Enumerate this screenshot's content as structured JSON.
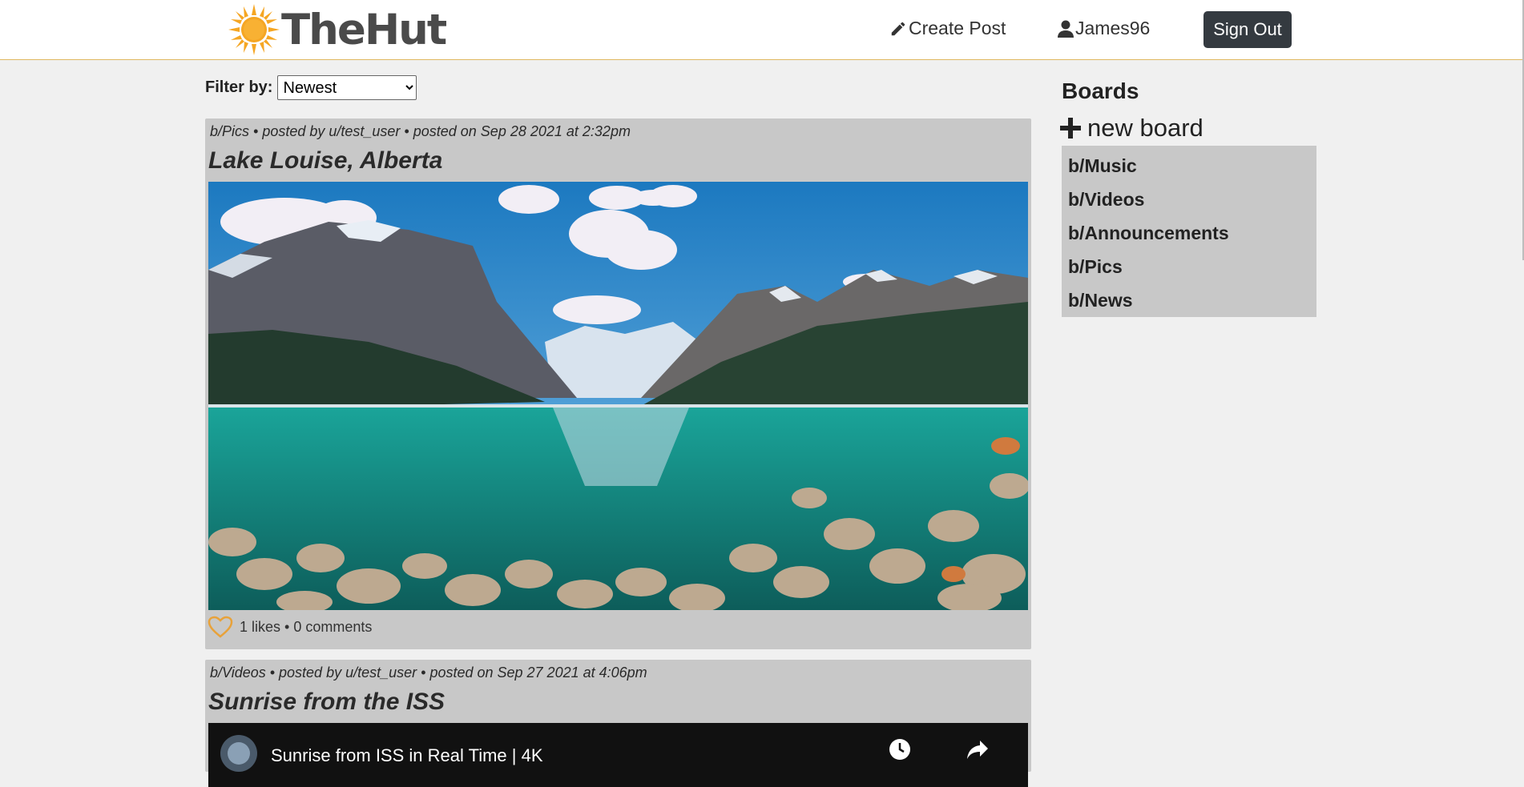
{
  "app": {
    "logo_text": "TheHut"
  },
  "nav": {
    "create_post": "Create Post",
    "username": "James96",
    "sign_out": "Sign Out"
  },
  "filter": {
    "label": "Filter by:",
    "selected": "Newest",
    "options": [
      "Newest"
    ]
  },
  "posts": [
    {
      "meta": "b/Pics • posted by u/test_user • posted on Sep 28 2021 at 2:32pm",
      "title": "Lake Louise, Alberta",
      "stats": "1 likes • 0 comments"
    },
    {
      "meta": "b/Videos • posted by u/test_user • posted on Sep 27 2021 at 4:06pm",
      "title": "Sunrise from the ISS",
      "video_title": "Sunrise from ISS in Real Time | 4K"
    }
  ],
  "sidebar": {
    "heading": "Boards",
    "new_board": "new board",
    "boards": [
      "b/Music",
      "b/Videos",
      "b/Announcements",
      "b/Pics",
      "b/News"
    ]
  },
  "colors": {
    "brand_sun": "#f5a623",
    "header_border": "#e0b860",
    "card_bg": "#c8c8c8",
    "button_dark": "#343a40",
    "like_heart": "#e8a23a"
  }
}
